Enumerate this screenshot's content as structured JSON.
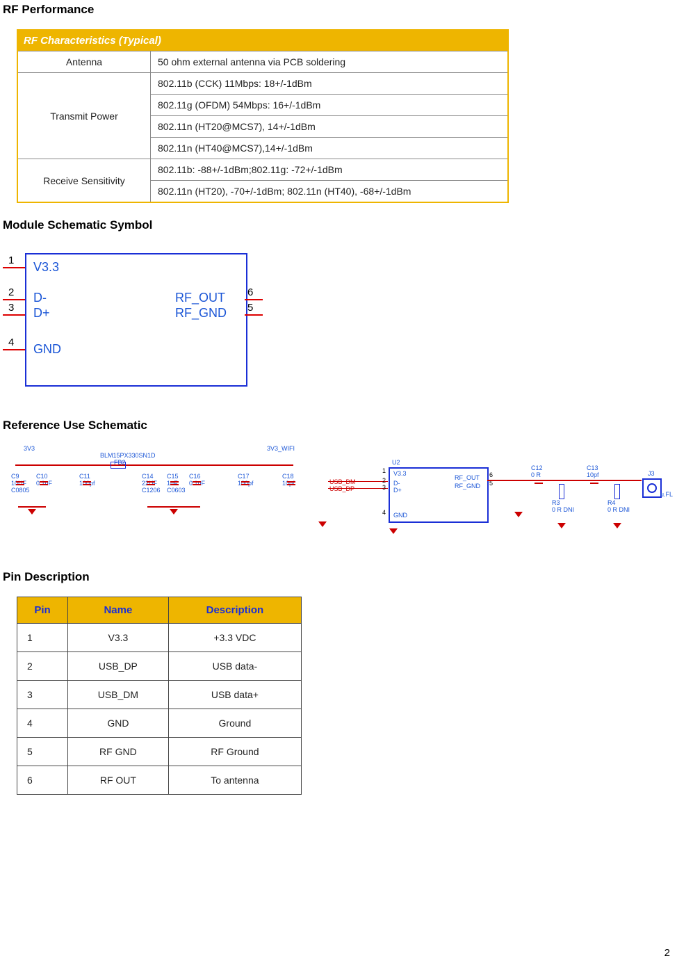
{
  "page_number": "2",
  "sections": {
    "rf_perf": "RF Performance",
    "symbol": "Module Schematic Symbol",
    "ref_schem": "Reference Use Schematic",
    "pin_desc": "Pin Description"
  },
  "rf_table": {
    "header": "RF Characteristics (Typical)",
    "rows": [
      {
        "label": "Antenna",
        "span": 1,
        "values": [
          "50 ohm external antenna via PCB soldering"
        ]
      },
      {
        "label": "Transmit Power",
        "span": 4,
        "values": [
          "802.11b (CCK) 11Mbps: 18+/-1dBm",
          "802.11g (OFDM) 54Mbps: 16+/-1dBm",
          "802.11n (HT20@MCS7), 14+/-1dBm",
          "802.11n (HT40@MCS7),14+/-1dBm"
        ]
      },
      {
        "label": "Receive Sensitivity",
        "span": 2,
        "values": [
          "802.11b: -88+/-1dBm;802.11g: -72+/-1dBm",
          "802.11n (HT20), -70+/-1dBm; 802.11n (HT40), -68+/-1dBm"
        ]
      }
    ]
  },
  "symbol": {
    "left_pins": [
      {
        "num": "1",
        "label": "V3.3"
      },
      {
        "num": "2",
        "label": "D-"
      },
      {
        "num": "3",
        "label": "D+"
      },
      {
        "num": "4",
        "label": "GND"
      }
    ],
    "right_pins": [
      {
        "num": "6",
        "label": "RF_OUT"
      },
      {
        "num": "5",
        "label": "RF_GND"
      }
    ]
  },
  "ref_schematic": {
    "net_3v3": "3V3",
    "net_3v3_wifi": "3V3_WIFI",
    "fb": {
      "ref": "FB2",
      "pn": "BLM15PX330SN1D"
    },
    "caps": [
      {
        "ref": "C9",
        "val": "10UF",
        "pkg": "C0805"
      },
      {
        "ref": "C10",
        "val": "0.1uF",
        "pkg": ""
      },
      {
        "ref": "C11",
        "val": "100pf",
        "pkg": ""
      },
      {
        "ref": "C14",
        "val": "22UF",
        "pkg": "C1206"
      },
      {
        "ref": "C15",
        "val": "1uF",
        "pkg": "C0603"
      },
      {
        "ref": "C16",
        "val": "0.1uF",
        "pkg": ""
      },
      {
        "ref": "C17",
        "val": "100pf",
        "pkg": ""
      },
      {
        "ref": "C18",
        "val": "10pf",
        "pkg": ""
      }
    ],
    "usb": [
      "USB_DM",
      "USB_DP"
    ],
    "u2": {
      "ref": "U2",
      "pins": [
        "V3.3",
        "D-",
        "D+",
        "GND",
        "RF_OUT",
        "RF_GND"
      ],
      "pinnums_l": [
        "1",
        "2",
        "3",
        "4"
      ],
      "pinnums_r": [
        "6",
        "5"
      ]
    },
    "out": [
      {
        "ref": "C12",
        "val": "0 R"
      },
      {
        "ref": "C13",
        "val": "10pf"
      },
      {
        "ref": "R3",
        "val": "0 R DNI"
      },
      {
        "ref": "R4",
        "val": "0 R DNI"
      }
    ],
    "conn": {
      "ref": "J3",
      "type": "u.FL"
    }
  },
  "pin_table": {
    "headers": [
      "Pin",
      "Name",
      "Description"
    ],
    "rows": [
      {
        "pin": "1",
        "name": "V3.3",
        "desc": "+3.3 VDC"
      },
      {
        "pin": "2",
        "name": "USB_DP",
        "desc": "USB data-"
      },
      {
        "pin": "3",
        "name": "USB_DM",
        "desc": "USB data+"
      },
      {
        "pin": "4",
        "name": "GND",
        "desc": "Ground"
      },
      {
        "pin": "5",
        "name": "RF GND",
        "desc": "RF Ground"
      },
      {
        "pin": "6",
        "name": "RF OUT",
        "desc": "To antenna"
      }
    ]
  }
}
